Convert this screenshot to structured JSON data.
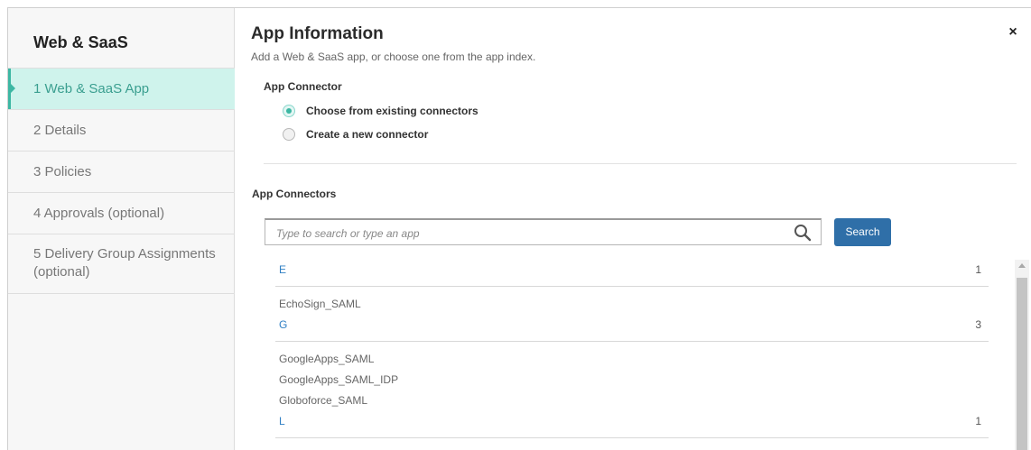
{
  "sidebar": {
    "title": "Web & SaaS",
    "steps": [
      {
        "label": "1  Web & SaaS App",
        "active": true
      },
      {
        "label": "2  Details"
      },
      {
        "label": "3  Policies"
      },
      {
        "label": "4  Approvals (optional)"
      },
      {
        "label": "5  Delivery Group Assignments (optional)"
      }
    ]
  },
  "header": {
    "title": "App Information",
    "subtitle": "Add a Web & SaaS app, or choose one from the app index.",
    "close_icon": "×"
  },
  "connector": {
    "section_label": "App Connector",
    "options": [
      {
        "label": "Choose from existing connectors",
        "checked": true
      },
      {
        "label": "Create a new connector",
        "checked": false
      }
    ]
  },
  "connectors": {
    "section_label": "App Connectors",
    "search_placeholder": "Type to search or type an app",
    "search_button": "Search",
    "groups": [
      {
        "letter": "E",
        "count": "1",
        "apps": [
          "EchoSign_SAML"
        ]
      },
      {
        "letter": "G",
        "count": "3",
        "apps": [
          "GoogleApps_SAML",
          "GoogleApps_SAML_IDP",
          "Globoforce_SAML"
        ]
      },
      {
        "letter": "L",
        "count": "1",
        "apps": []
      }
    ]
  },
  "colors": {
    "accent": "#3cb7a3",
    "active_step_bg": "#cff3ec",
    "button": "#2f6fa8",
    "link": "#2f7fc4"
  },
  "icons": {
    "close": "close-icon",
    "search": "search-icon",
    "scroll_up": "chevron-up-icon"
  }
}
